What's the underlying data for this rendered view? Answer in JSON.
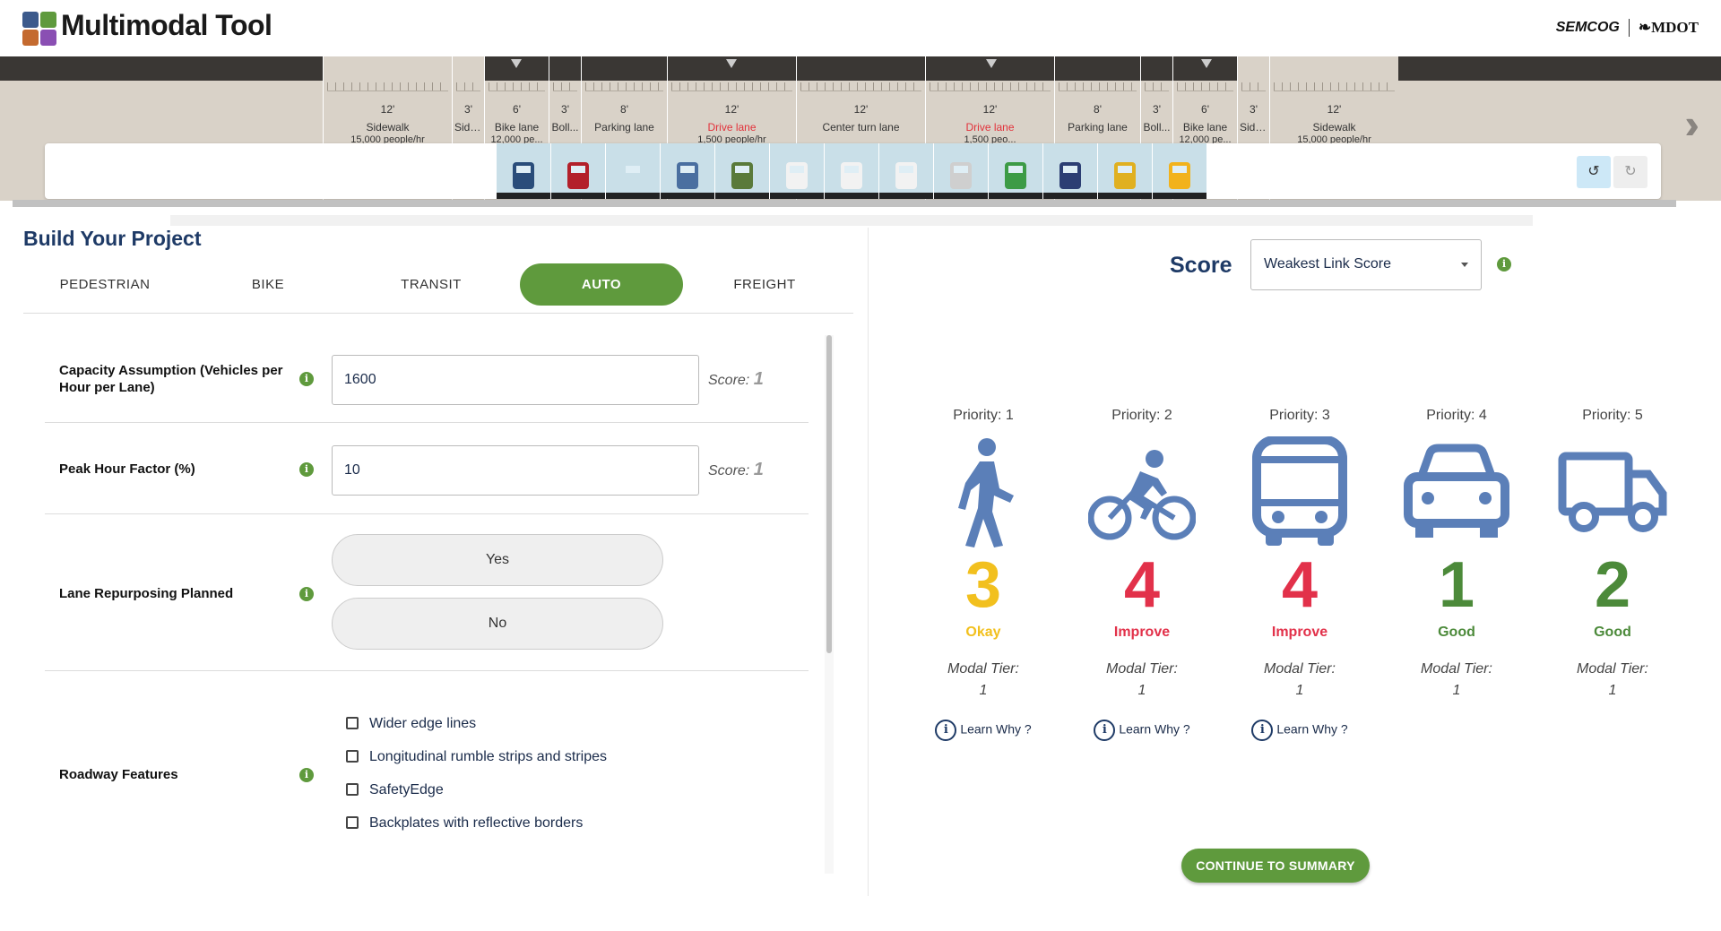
{
  "app": {
    "title": "Multimodal Tool",
    "partner_1": "SEMCOG",
    "partner_2": "MDOT",
    "logo_colors": [
      "#3c5a8c",
      "#5f9a3d",
      "#c46a2f",
      "#8a4fb3"
    ]
  },
  "street": {
    "segments": [
      {
        "width": "12'",
        "name": "Sidewalk",
        "capacity": "15,000 people/hr",
        "name_color": "normal"
      },
      {
        "width": "3'",
        "name": "Side...",
        "capacity": "",
        "name_color": "normal"
      },
      {
        "width": "6'",
        "name": "Bike lane",
        "capacity": "12,000 pe...",
        "name_color": "normal"
      },
      {
        "width": "3'",
        "name": "Boll...",
        "capacity": "",
        "name_color": "normal"
      },
      {
        "width": "8'",
        "name": "Parking lane",
        "capacity": "",
        "name_color": "normal"
      },
      {
        "width": "12'",
        "name": "Drive lane",
        "capacity": "1,500 people/hr",
        "name_color": "red"
      },
      {
        "width": "12'",
        "name": "Center turn lane",
        "capacity": "",
        "name_color": "normal"
      },
      {
        "width": "12'",
        "name": "Drive lane",
        "capacity": "1,500 peo...",
        "name_color": "red"
      },
      {
        "width": "8'",
        "name": "Parking lane",
        "capacity": "",
        "name_color": "normal"
      },
      {
        "width": "3'",
        "name": "Boll...",
        "capacity": "",
        "name_color": "normal"
      },
      {
        "width": "6'",
        "name": "Bike lane",
        "capacity": "12,000 pe...",
        "name_color": "normal"
      },
      {
        "width": "3'",
        "name": "Side...",
        "capacity": "",
        "name_color": "normal"
      },
      {
        "width": "12'",
        "name": "Sidewalk",
        "capacity": "15,000 people/hr",
        "name_color": "normal"
      }
    ],
    "palette_icons": [
      "pedestrians-icon",
      "planter-bench-icon",
      "flower-planter-icon",
      "cyclist-icon",
      "cyclist-helmet-icon",
      "car-front-icon",
      "car-icon",
      "sedan-icon",
      "bus-rear-icon",
      "streetcar-icon",
      "light-rail-icon",
      "transit-shelter-icon",
      "bus-front-icon"
    ],
    "undo_icon": "undo-icon",
    "redo_icon": "redo-icon"
  },
  "build": {
    "title": "Build Your Project",
    "tabs": [
      "PEDESTRIAN",
      "BIKE",
      "TRANSIT",
      "AUTO",
      "FREIGHT"
    ],
    "active_tab": "AUTO",
    "fields": {
      "capacity": {
        "label": "Capacity Assumption (Vehicles per Hour per Lane)",
        "value": "1600",
        "score_prefix": "Score:",
        "score": "1"
      },
      "peak": {
        "label": "Peak Hour Factor (%)",
        "value": "10",
        "score_prefix": "Score:",
        "score": "1"
      },
      "repurpose": {
        "label": "Lane Repurposing Planned",
        "yes": "Yes",
        "no": "No"
      },
      "features": {
        "label": "Roadway Features",
        "options": [
          "Wider edge lines",
          "Longitudinal rumble strips and stripes",
          "SafetyEdge",
          "Backplates with reflective borders"
        ]
      }
    }
  },
  "score": {
    "title": "Score",
    "select_value": "Weakest Link Score",
    "modes": [
      {
        "priority": "Priority: 1",
        "icon": "pedestrian-icon",
        "value": "3",
        "rating": "Okay",
        "color": "#f2c01e",
        "tier_label": "Modal Tier:",
        "tier": "1",
        "learn": "Learn Why ?"
      },
      {
        "priority": "Priority: 2",
        "icon": "bicycle-icon",
        "value": "4",
        "rating": "Improve",
        "color": "#e2314a",
        "tier_label": "Modal Tier:",
        "tier": "1",
        "learn": "Learn Why ?"
      },
      {
        "priority": "Priority: 3",
        "icon": "bus-icon",
        "value": "4",
        "rating": "Improve",
        "color": "#e2314a",
        "tier_label": "Modal Tier:",
        "tier": "1",
        "learn": "Learn Why ?"
      },
      {
        "priority": "Priority: 4",
        "icon": "car-icon",
        "value": "1",
        "rating": "Good",
        "color": "#4c8a3a",
        "tier_label": "Modal Tier:",
        "tier": "1",
        "learn": ""
      },
      {
        "priority": "Priority: 5",
        "icon": "truck-icon",
        "value": "2",
        "rating": "Good",
        "color": "#4c8a3a",
        "tier_label": "Modal Tier:",
        "tier": "1",
        "learn": ""
      }
    ],
    "icon_color": "#5b7fb8",
    "continue": "CONTINUE TO SUMMARY"
  }
}
